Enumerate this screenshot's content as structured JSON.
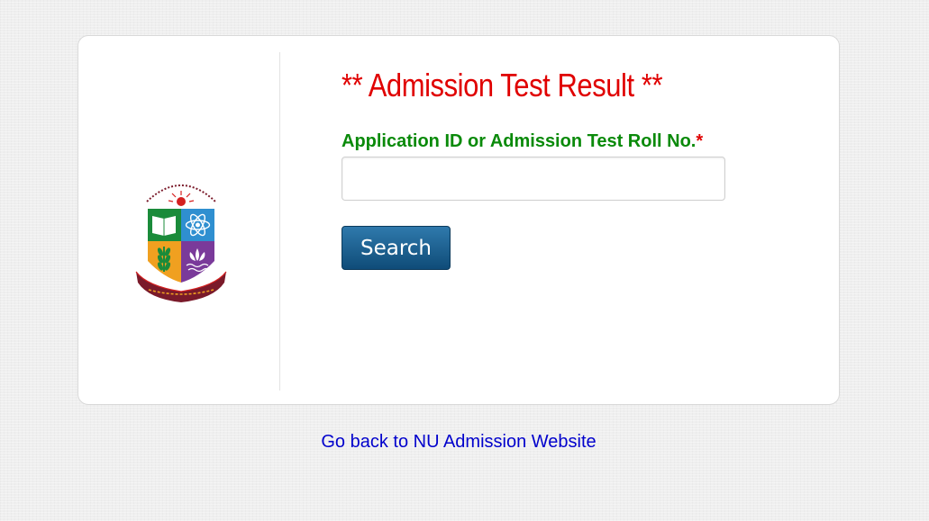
{
  "form": {
    "title": "** Admission Test Result **",
    "field_label": "Application ID or Admission Test Roll No.",
    "required_marker": "*",
    "input_value": "",
    "search_label": "Search"
  },
  "footer": {
    "back_link": "Go back to NU Admission Website"
  },
  "logo": {
    "icon": "national-university-emblem",
    "colors": {
      "green": "#1a8b3a",
      "blue": "#2f8fd0",
      "orange": "#f0a020",
      "purple": "#7a3a9a",
      "maroon": "#7a1a2a",
      "red": "#d42020"
    }
  },
  "colors": {
    "title": "#e00000",
    "label": "#0a8a0a",
    "button": "#1a5a88",
    "link": "#0000cc"
  }
}
